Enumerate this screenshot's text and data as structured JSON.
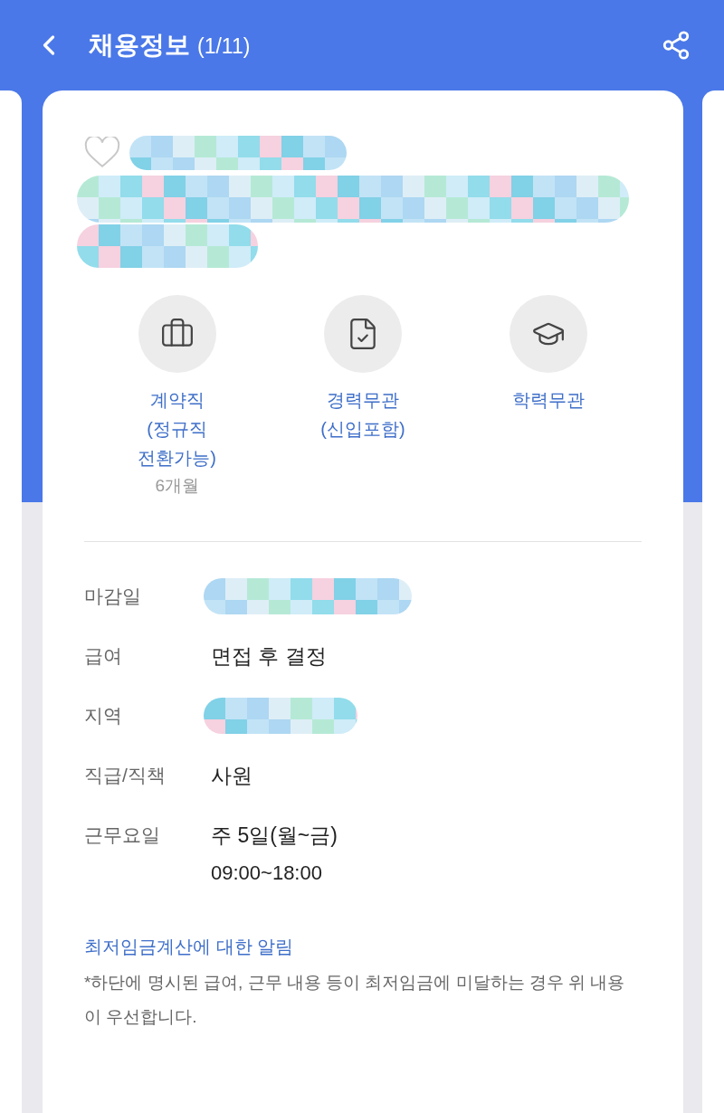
{
  "header": {
    "title": "채용정보",
    "counter": "(1/11)"
  },
  "conditions": [
    {
      "kind": "briefcase",
      "lines": [
        "계약직",
        "(정규직",
        "전환가능)"
      ],
      "note": "6개월"
    },
    {
      "kind": "document",
      "lines": [
        "경력무관",
        "(신입포함)"
      ]
    },
    {
      "kind": "cap",
      "lines": [
        "학력무관"
      ]
    }
  ],
  "details": [
    {
      "label": "마감일",
      "kind": "redacted"
    },
    {
      "label": "급여",
      "kind": "text",
      "lines": [
        "면접 후 결정"
      ]
    },
    {
      "label": "지역",
      "kind": "redacted"
    },
    {
      "label": "직급/직책",
      "kind": "text",
      "lines": [
        "사원"
      ]
    },
    {
      "label": "근무요일",
      "kind": "text",
      "lines": [
        "주 5일(월~금)",
        "09:00~18:00"
      ]
    }
  ],
  "notice": {
    "link": "최저임금계산에 대한 알림",
    "body": "*하단에 명시된 급여, 근무 내용 등이 최저임금에 미달하는 경우 위 내용이 우선합니다."
  }
}
